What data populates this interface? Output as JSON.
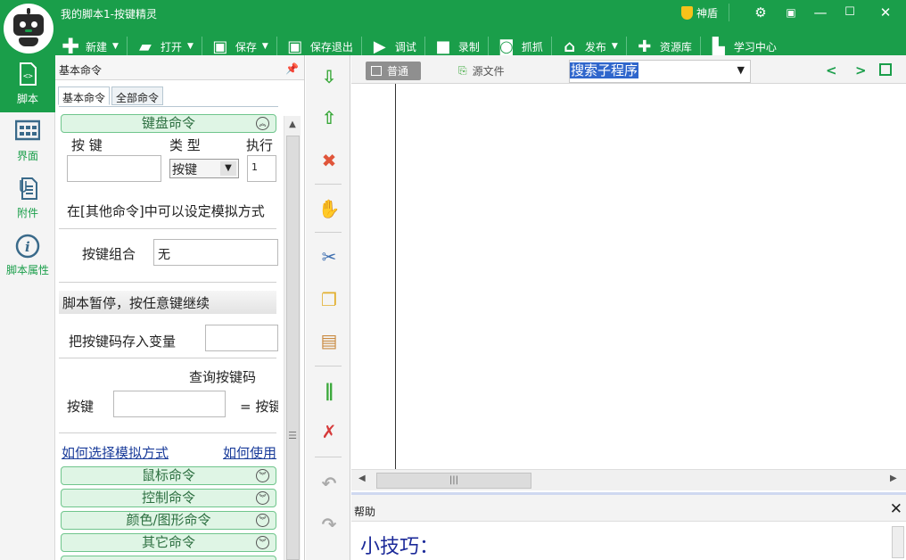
{
  "window": {
    "title": "我的脚本1-按键精灵",
    "shield_label": "神盾"
  },
  "toolbar": {
    "new": "新建",
    "open": "打开",
    "save": "保存",
    "save_exit": "保存退出",
    "debug": "调试",
    "record": "录制",
    "capture": "抓抓",
    "publish": "发布",
    "resources": "资源库",
    "learn": "学习中心"
  },
  "leftnav": [
    {
      "label": "脚本"
    },
    {
      "label": "界面"
    },
    {
      "label": "附件"
    },
    {
      "label": "脚本属性"
    }
  ],
  "cmdpanel": {
    "title": "基本命令",
    "tabs": [
      "基本命令",
      "全部命令"
    ],
    "keyboard_section": "键盘命令",
    "col_key": "按 键",
    "col_type": "类 型",
    "col_exec": "执行",
    "type_value": "按键",
    "exec_value": "1",
    "hint": "在[其他命令]中可以设定模拟方式",
    "combo_label": "按键组合",
    "combo_value": "无",
    "pause_bar": "脚本暂停，按任意键继续",
    "store_label": "把按键码存入变量",
    "query_label": "查询按键码",
    "key_label": "按键",
    "eq_label": "= 按键",
    "link_choose": "如何选择模拟方式",
    "link_use": "如何使用",
    "sections": [
      "鼠标命令",
      "控制命令",
      "颜色/图形命令",
      "其它命令"
    ]
  },
  "editor": {
    "mode_normal": "普通",
    "mode_source": "源文件",
    "search_value": "搜索子程序"
  },
  "help": {
    "title": "帮助",
    "tip": "小技巧："
  }
}
